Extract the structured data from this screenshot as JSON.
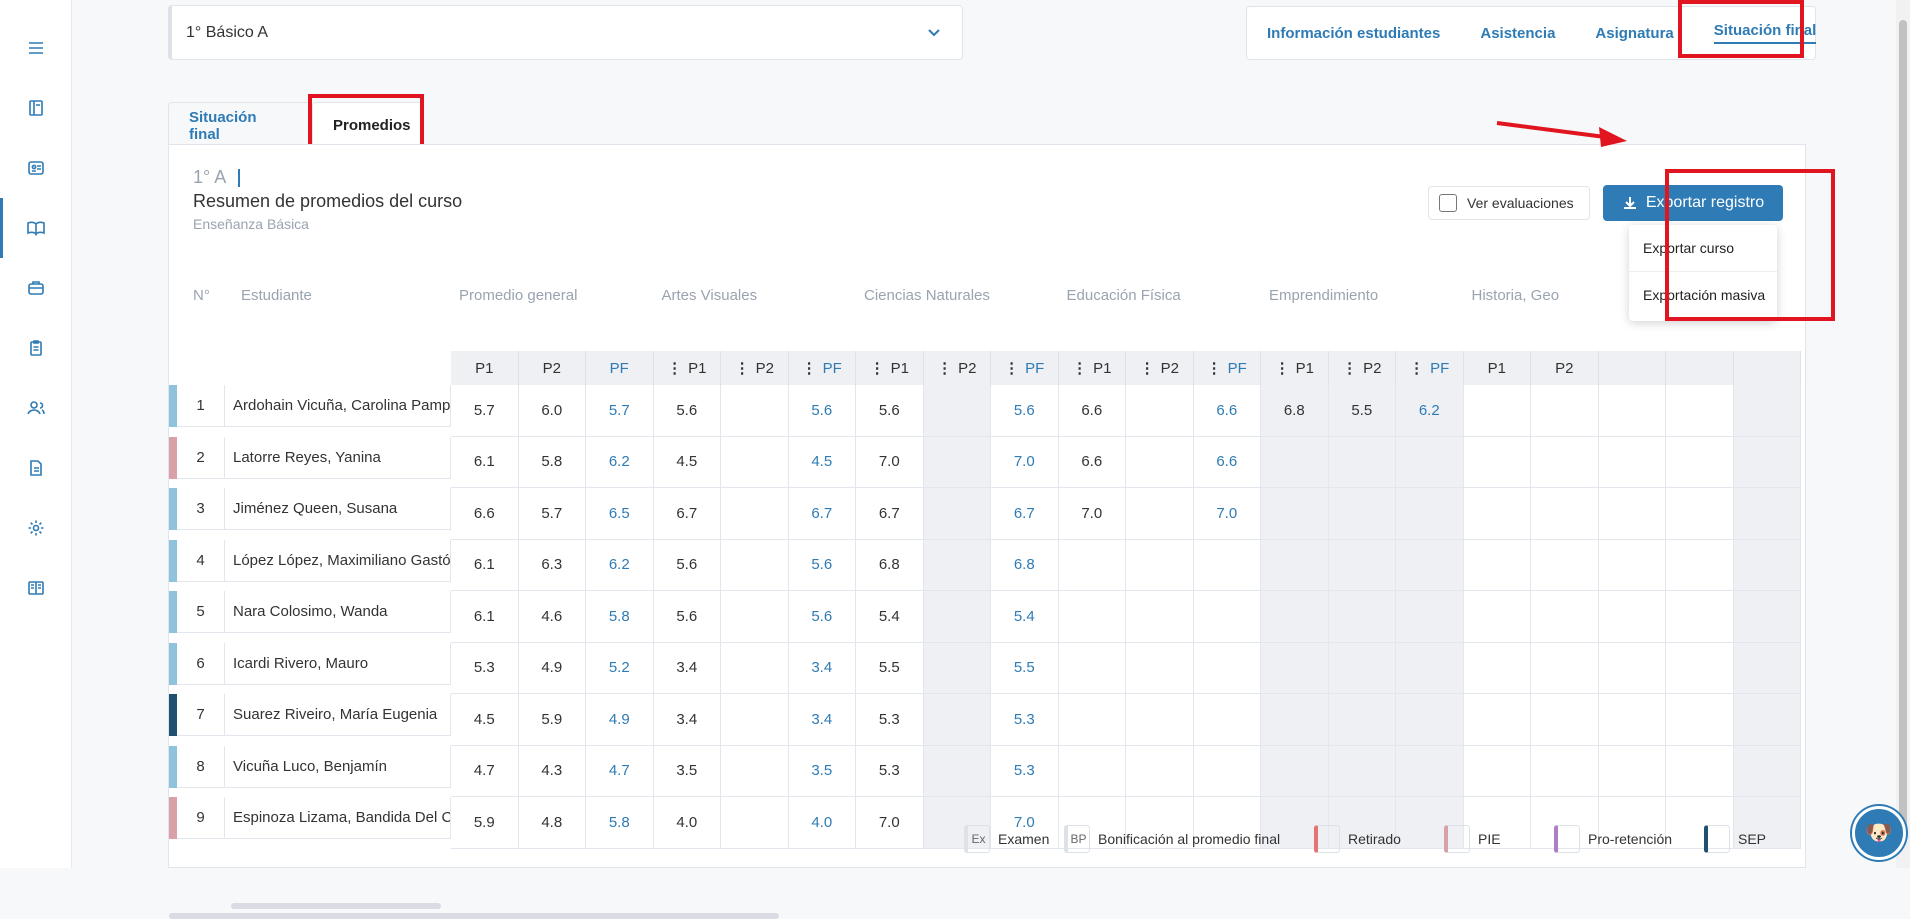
{
  "sidebar": {
    "icons": [
      "menu-icon",
      "notebook-icon",
      "id-card-icon",
      "book-icon",
      "briefcase-icon",
      "clipboard-icon",
      "users-icon",
      "document-icon",
      "gear-icon",
      "book-open-icon"
    ]
  },
  "course_select": {
    "value": "1° Básico A"
  },
  "top_nav": {
    "items": [
      "Información estudiantes",
      "Asistencia",
      "Asignatura",
      "Situación final"
    ]
  },
  "subtabs": {
    "situacion": "Situación final",
    "promedios": "Promedios"
  },
  "panel": {
    "code": "1° A",
    "title": "Resumen de promedios del curso",
    "subtitle": "Enseñanza Básica",
    "ver_evaluaciones": "Ver evaluaciones",
    "export_label": "Exportar registro",
    "dropdown": [
      "Exportar curso",
      "Exportación masiva"
    ]
  },
  "table": {
    "col_num": "N°",
    "col_name": "Estudiante",
    "groups": [
      "Promedio general",
      "Artes Visuales",
      "Ciencias Naturales",
      "Educación Física",
      "Emprendimiento",
      "Historia, Geo"
    ],
    "sub": [
      "P1",
      "P2",
      "PF"
    ],
    "rows": [
      {
        "n": "1",
        "name": "Ardohain Vicuña, Carolina Pampita",
        "flag": "#8fc3dc",
        "v": [
          "5.7",
          "6.0",
          "5.7",
          "5.6",
          "",
          "5.6",
          "5.6",
          "",
          "5.6",
          "6.6",
          "",
          "6.6",
          "6.8",
          "5.5",
          "6.2"
        ]
      },
      {
        "n": "2",
        "name": "Latorre Reyes, Yanina",
        "flag": "#d7a1a7",
        "v": [
          "6.1",
          "5.8",
          "6.2",
          "4.5",
          "",
          "4.5",
          "7.0",
          "",
          "7.0",
          "6.6",
          "",
          "6.6",
          "",
          "",
          ""
        ]
      },
      {
        "n": "3",
        "name": "Jiménez Queen, Susana",
        "flag": "#8fc3dc",
        "v": [
          "6.6",
          "5.7",
          "6.5",
          "6.7",
          "",
          "6.7",
          "6.7",
          "",
          "6.7",
          "7.0",
          "",
          "7.0",
          "",
          "",
          ""
        ]
      },
      {
        "n": "4",
        "name": "López López, Maximiliano Gastón",
        "flag": "#8fc3dc",
        "v": [
          "6.1",
          "6.3",
          "6.2",
          "5.6",
          "",
          "5.6",
          "6.8",
          "",
          "6.8",
          "",
          "",
          "",
          "",
          "",
          ""
        ]
      },
      {
        "n": "5",
        "name": "Nara Colosimo, Wanda",
        "flag": "#8fc3dc",
        "v": [
          "6.1",
          "4.6",
          "5.8",
          "5.6",
          "",
          "5.6",
          "5.4",
          "",
          "5.4",
          "",
          "",
          "",
          "",
          "",
          ""
        ]
      },
      {
        "n": "6",
        "name": "Icardi Rivero, Mauro",
        "flag": "#8fc3dc",
        "v": [
          "5.3",
          "4.9",
          "5.2",
          "3.4",
          "",
          "3.4",
          "5.5",
          "",
          "5.5",
          "",
          "",
          "",
          "",
          "",
          ""
        ]
      },
      {
        "n": "7",
        "name": "Suarez Riveiro, María Eugenia",
        "flag": "#1f5070",
        "v": [
          "4.5",
          "5.9",
          "4.9",
          "3.4",
          "",
          "3.4",
          "5.3",
          "",
          "5.3",
          "",
          "",
          "",
          "",
          "",
          ""
        ]
      },
      {
        "n": "8",
        "name": "Vicuña Luco, Benjamín",
        "flag": "#8fc3dc",
        "v": [
          "4.7",
          "4.3",
          "4.7",
          "3.5",
          "",
          "3.5",
          "5.3",
          "",
          "5.3",
          "",
          "",
          "",
          "",
          "",
          ""
        ]
      },
      {
        "n": "9",
        "name": "Espinoza Lizama, Bandida Del Carmen",
        "flag": "#d7a1a7",
        "v": [
          "5.9",
          "4.8",
          "5.8",
          "4.0",
          "",
          "4.0",
          "7.0",
          "",
          "7.0",
          "",
          "",
          "",
          "",
          "",
          ""
        ]
      }
    ]
  },
  "legend": [
    {
      "box": "Ex",
      "label": "Examen",
      "color": ""
    },
    {
      "box": "BP",
      "label": "Bonificación al promedio final",
      "color": ""
    },
    {
      "box": "",
      "label": "Retirado",
      "color": "#e57373"
    },
    {
      "box": "",
      "label": "PIE",
      "color": "#d7a1a7"
    },
    {
      "box": "",
      "label": "Pro-retención",
      "color": "#b07cc6"
    },
    {
      "box": "",
      "label": "SEP",
      "color": "#1f5070"
    }
  ],
  "colors": {
    "accent": "#2e7bb5",
    "highlight": "#e0151f"
  }
}
